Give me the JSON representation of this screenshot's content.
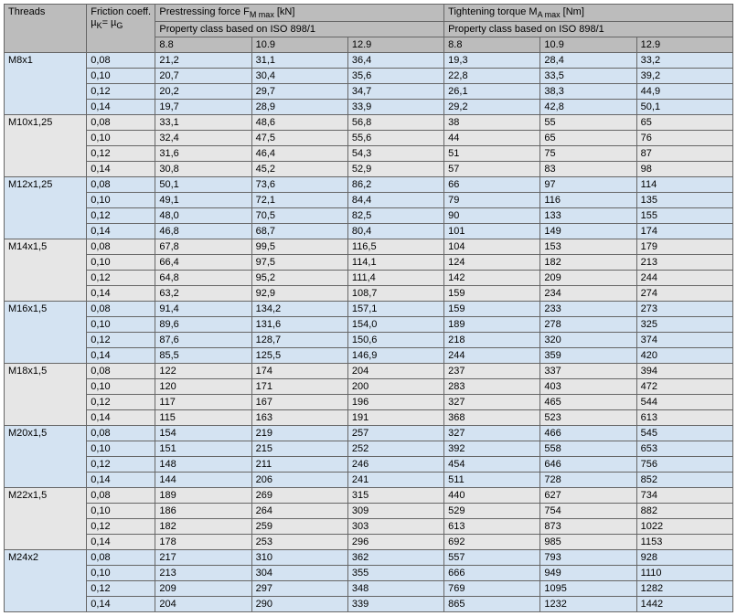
{
  "headers": {
    "threads": "Threads",
    "friction_html": "Friction coeff.<br>µ<sub>K</sub>= µ<sub>G</sub>",
    "force_html": "Prestressing force F<sub>M max</sub> [kN]",
    "torque_html": "Tightening torque M<sub>A max</sub> [Nm]",
    "propclass": "Property class based on ISO 898/1",
    "c88": "8.8",
    "c109": "10.9",
    "c129": "12.9"
  },
  "groups": [
    {
      "thread": "M8x1",
      "rows": [
        {
          "mu": "0,08",
          "f": [
            "21,2",
            "31,1",
            "36,4"
          ],
          "t": [
            "19,3",
            "28,4",
            "33,2"
          ]
        },
        {
          "mu": "0,10",
          "f": [
            "20,7",
            "30,4",
            "35,6"
          ],
          "t": [
            "22,8",
            "33,5",
            "39,2"
          ]
        },
        {
          "mu": "0,12",
          "f": [
            "20,2",
            "29,7",
            "34,7"
          ],
          "t": [
            "26,1",
            "38,3",
            "44,9"
          ]
        },
        {
          "mu": "0,14",
          "f": [
            "19,7",
            "28,9",
            "33,9"
          ],
          "t": [
            "29,2",
            "42,8",
            "50,1"
          ]
        }
      ]
    },
    {
      "thread": "M10x1,25",
      "rows": [
        {
          "mu": "0,08",
          "f": [
            "33,1",
            "48,6",
            "56,8"
          ],
          "t": [
            "38",
            "55",
            "65"
          ]
        },
        {
          "mu": "0,10",
          "f": [
            "32,4",
            "47,5",
            "55,6"
          ],
          "t": [
            "44",
            "65",
            "76"
          ]
        },
        {
          "mu": "0,12",
          "f": [
            "31,6",
            "46,4",
            "54,3"
          ],
          "t": [
            "51",
            "75",
            "87"
          ]
        },
        {
          "mu": "0,14",
          "f": [
            "30,8",
            "45,2",
            "52,9"
          ],
          "t": [
            "57",
            "83",
            "98"
          ]
        }
      ]
    },
    {
      "thread": "M12x1,25",
      "rows": [
        {
          "mu": "0,08",
          "f": [
            "50,1",
            "73,6",
            "86,2"
          ],
          "t": [
            "66",
            "97",
            "114"
          ]
        },
        {
          "mu": "0,10",
          "f": [
            "49,1",
            "72,1",
            "84,4"
          ],
          "t": [
            "79",
            "116",
            "135"
          ]
        },
        {
          "mu": "0,12",
          "f": [
            "48,0",
            "70,5",
            "82,5"
          ],
          "t": [
            "90",
            "133",
            "155"
          ]
        },
        {
          "mu": "0,14",
          "f": [
            "46,8",
            "68,7",
            "80,4"
          ],
          "t": [
            "101",
            "149",
            "174"
          ]
        }
      ]
    },
    {
      "thread": "M14x1,5",
      "rows": [
        {
          "mu": "0,08",
          "f": [
            "67,8",
            "99,5",
            "116,5"
          ],
          "t": [
            "104",
            "153",
            "179"
          ]
        },
        {
          "mu": "0,10",
          "f": [
            "66,4",
            "97,5",
            "114,1"
          ],
          "t": [
            "124",
            "182",
            "213"
          ]
        },
        {
          "mu": "0,12",
          "f": [
            "64,8",
            "95,2",
            "111,4"
          ],
          "t": [
            "142",
            "209",
            "244"
          ]
        },
        {
          "mu": "0,14",
          "f": [
            "63,2",
            "92,9",
            "108,7"
          ],
          "t": [
            "159",
            "234",
            "274"
          ]
        }
      ]
    },
    {
      "thread": "M16x1,5",
      "rows": [
        {
          "mu": "0,08",
          "f": [
            "91,4",
            "134,2",
            "157,1"
          ],
          "t": [
            "159",
            "233",
            "273"
          ]
        },
        {
          "mu": "0,10",
          "f": [
            "89,6",
            "131,6",
            "154,0"
          ],
          "t": [
            "189",
            "278",
            "325"
          ]
        },
        {
          "mu": "0,12",
          "f": [
            "87,6",
            "128,7",
            "150,6"
          ],
          "t": [
            "218",
            "320",
            "374"
          ]
        },
        {
          "mu": "0,14",
          "f": [
            "85,5",
            "125,5",
            "146,9"
          ],
          "t": [
            "244",
            "359",
            "420"
          ]
        }
      ]
    },
    {
      "thread": "M18x1,5",
      "rows": [
        {
          "mu": "0,08",
          "f": [
            "122",
            "174",
            "204"
          ],
          "t": [
            "237",
            "337",
            "394"
          ]
        },
        {
          "mu": "0,10",
          "f": [
            "120",
            "171",
            "200"
          ],
          "t": [
            "283",
            "403",
            "472"
          ]
        },
        {
          "mu": "0,12",
          "f": [
            "117",
            "167",
            "196"
          ],
          "t": [
            "327",
            "465",
            "544"
          ]
        },
        {
          "mu": "0,14",
          "f": [
            "115",
            "163",
            "191"
          ],
          "t": [
            "368",
            "523",
            "613"
          ]
        }
      ]
    },
    {
      "thread": "M20x1,5",
      "rows": [
        {
          "mu": "0,08",
          "f": [
            "154",
            "219",
            "257"
          ],
          "t": [
            "327",
            "466",
            "545"
          ]
        },
        {
          "mu": "0,10",
          "f": [
            "151",
            "215",
            "252"
          ],
          "t": [
            "392",
            "558",
            "653"
          ]
        },
        {
          "mu": "0,12",
          "f": [
            "148",
            "211",
            "246"
          ],
          "t": [
            "454",
            "646",
            "756"
          ]
        },
        {
          "mu": "0,14",
          "f": [
            "144",
            "206",
            "241"
          ],
          "t": [
            "511",
            "728",
            "852"
          ]
        }
      ]
    },
    {
      "thread": "M22x1,5",
      "rows": [
        {
          "mu": "0,08",
          "f": [
            "189",
            "269",
            "315"
          ],
          "t": [
            "440",
            "627",
            "734"
          ]
        },
        {
          "mu": "0,10",
          "f": [
            "186",
            "264",
            "309"
          ],
          "t": [
            "529",
            "754",
            "882"
          ]
        },
        {
          "mu": "0,12",
          "f": [
            "182",
            "259",
            "303"
          ],
          "t": [
            "613",
            "873",
            "1022"
          ]
        },
        {
          "mu": "0,14",
          "f": [
            "178",
            "253",
            "296"
          ],
          "t": [
            "692",
            "985",
            "1153"
          ]
        }
      ]
    },
    {
      "thread": "M24x2",
      "rows": [
        {
          "mu": "0,08",
          "f": [
            "217",
            "310",
            "362"
          ],
          "t": [
            "557",
            "793",
            "928"
          ]
        },
        {
          "mu": "0,10",
          "f": [
            "213",
            "304",
            "355"
          ],
          "t": [
            "666",
            "949",
            "1110"
          ]
        },
        {
          "mu": "0,12",
          "f": [
            "209",
            "297",
            "348"
          ],
          "t": [
            "769",
            "1095",
            "1282"
          ]
        },
        {
          "mu": "0,14",
          "f": [
            "204",
            "290",
            "339"
          ],
          "t": [
            "865",
            "1232",
            "1442"
          ]
        }
      ]
    }
  ]
}
